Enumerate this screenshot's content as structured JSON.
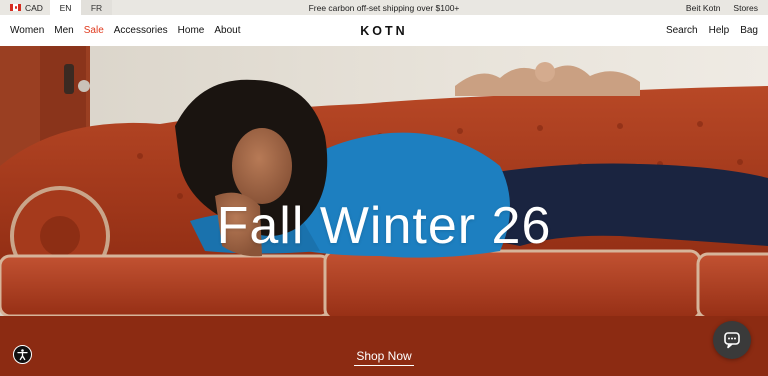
{
  "topbar": {
    "currency": "CAD",
    "languages": [
      "EN",
      "FR"
    ],
    "active_language": "EN",
    "promo": "Free carbon off-set shipping over $100+",
    "links": [
      "Beit Kotn",
      "Stores"
    ]
  },
  "nav": {
    "logo": "KOTN",
    "left": [
      "Women",
      "Men",
      "Sale",
      "Accessories",
      "Home",
      "About"
    ],
    "right": [
      "Search",
      "Help",
      "Bag"
    ]
  },
  "hero": {
    "title": "Fall Winter 26",
    "cta": "Shop Now"
  },
  "icons": {
    "flag": "canada-flag-icon",
    "accessibility": "accessibility-icon",
    "chat": "chat-icon"
  },
  "colors": {
    "topbar_bg": "#e9e7e2",
    "sale": "#e03a1e",
    "sofa": "#a8381a",
    "sweater": "#1d7fc0",
    "pants": "#1a2440"
  }
}
